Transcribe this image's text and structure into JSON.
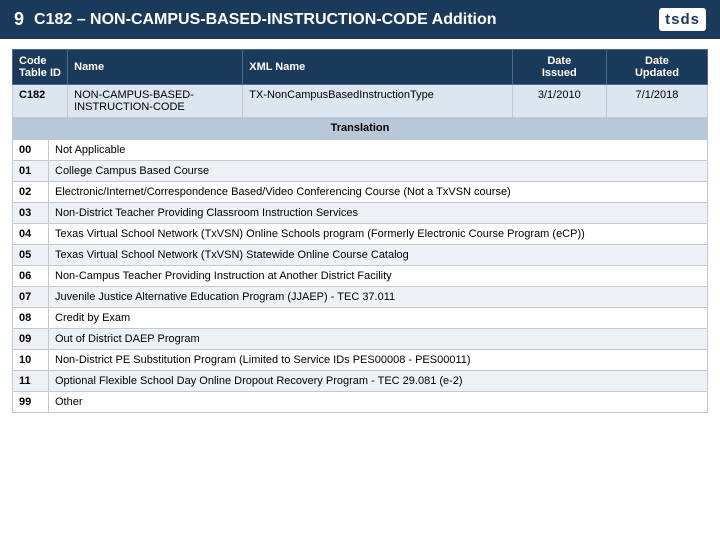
{
  "header": {
    "page_number": "9",
    "title": "C182 – NON-CAMPUS-BASED-INSTRUCTION-CODE Addition",
    "logo": "tsds"
  },
  "table": {
    "columns": {
      "code_table_id": "Code\nTable ID",
      "name": "Name",
      "xml_name": "XML Name",
      "date_issued": "Date\nIssued",
      "date_updated": "Date\nUpdated"
    },
    "data_row": {
      "code": "C182",
      "name": "NON-CAMPUS-BASED-INSTRUCTION-CODE",
      "xml_name": "TX-NonCampusBasedInstructionType",
      "date_issued": "3/1/2010",
      "date_updated": "7/1/2018"
    },
    "translation_label": "Translation",
    "translations": [
      {
        "code": "00",
        "description": "Not Applicable"
      },
      {
        "code": "01",
        "description": "College Campus Based Course"
      },
      {
        "code": "02",
        "description": "Electronic/Internet/Correspondence Based/Video Conferencing Course (Not a TxVSN course)"
      },
      {
        "code": "03",
        "description": "Non-District Teacher Providing Classroom Instruction Services"
      },
      {
        "code": "04",
        "description": "Texas Virtual School Network (TxVSN) Online Schools program (Formerly Electronic Course Program (eCP))"
      },
      {
        "code": "05",
        "description": "Texas Virtual School Network (TxVSN) Statewide Online Course Catalog"
      },
      {
        "code": "06",
        "description": "Non-Campus Teacher Providing Instruction at Another District Facility"
      },
      {
        "code": "07",
        "description": "Juvenile Justice Alternative Education Program (JJAEP) - TEC 37.011"
      },
      {
        "code": "08",
        "description": "Credit by Exam"
      },
      {
        "code": "09",
        "description": "Out of District DAEP Program"
      },
      {
        "code": "10",
        "description": "Non-District PE Substitution Program (Limited to Service IDs PES00008 - PES00011)"
      },
      {
        "code": "11",
        "description": "Optional Flexible School Day Online Dropout Recovery Program - TEC 29.081 (e-2)"
      },
      {
        "code": "99",
        "description": "Other"
      }
    ]
  }
}
